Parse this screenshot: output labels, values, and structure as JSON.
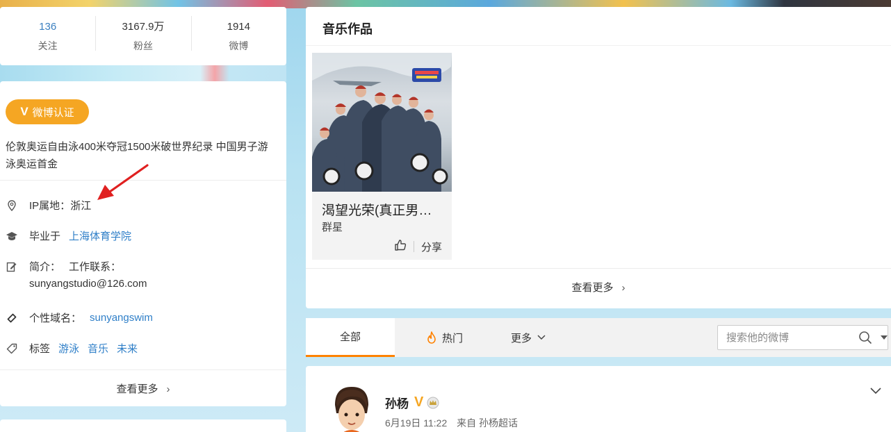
{
  "stats": [
    {
      "value": "136",
      "label": "关注"
    },
    {
      "value": "3167.9万",
      "label": "粉丝"
    },
    {
      "value": "1914",
      "label": "微博"
    }
  ],
  "profile": {
    "verify_label": "微博认证",
    "bio": "伦敦奥运自由泳400米夺冠1500米破世界纪录 中国男子游泳奥运首金",
    "ip_label": "IP属地：",
    "ip_value": "浙江",
    "school_prefix": "毕业于",
    "school_name": "上海体育学院",
    "intro_label": "简介：",
    "intro_text": "工作联系：",
    "intro_email": "sunyangstudio@126.com",
    "domain_label": "个性域名：",
    "domain_value": "sunyangswim",
    "tags_label": "标签",
    "tags": [
      "游泳",
      "音乐",
      "未来"
    ],
    "more_label": "查看更多"
  },
  "music": {
    "title": "音乐作品",
    "album_name": "渴望光荣(真正男…",
    "album_artist": "群星",
    "share_label": "分享",
    "more_label": "查看更多"
  },
  "tabs": {
    "all": "全部",
    "hot": "热门",
    "more": "更多",
    "search_placeholder": "搜索他的微博"
  },
  "feed": {
    "poster": "孙杨",
    "date": "6月19日 11:22",
    "source_prefix": "来自",
    "source": "孙杨超话"
  },
  "colors": {
    "accent_orange": "#ff8200",
    "verify_gold": "#f5a623",
    "link_blue": "#2f7fc8",
    "annotation_red": "#e02020"
  }
}
